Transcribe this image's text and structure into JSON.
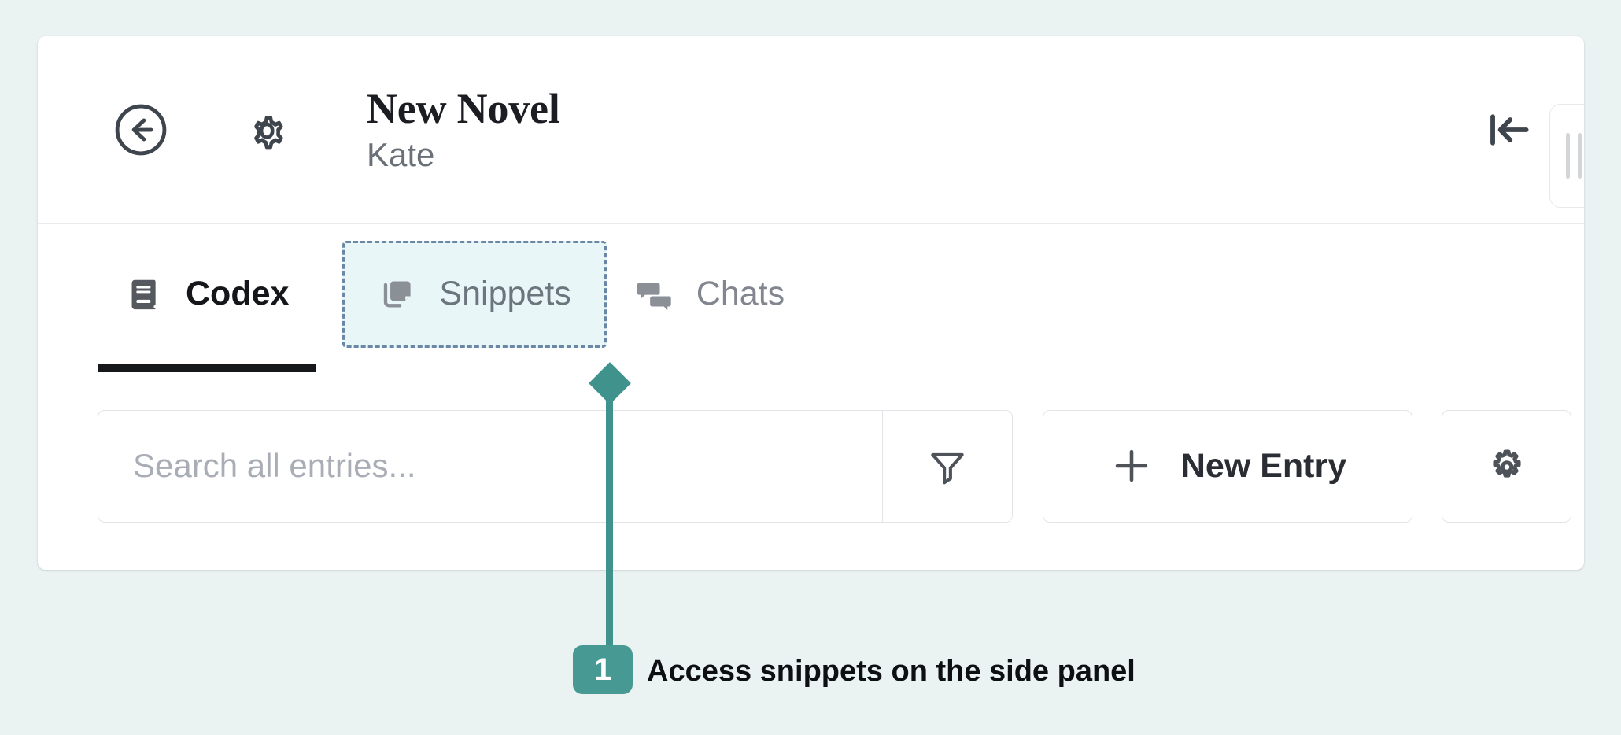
{
  "theme": {
    "page_background": "#eaf2f2",
    "panel_background": "#ffffff",
    "accent_teal": "#479a93",
    "highlight_fill": "#e9f6f8",
    "highlight_border": "#6a88a6",
    "active_tab_underline": "#16181c"
  },
  "header": {
    "back_icon": "arrow-left-circle-icon",
    "settings_icon": "gear-icon",
    "title": "New Novel",
    "author": "Kate",
    "collapse_icon": "collapse-panel-left-icon",
    "drag_handle_icon": "drag-handle-icon"
  },
  "tabs": [
    {
      "label": "Codex",
      "icon": "book-icon",
      "active": true,
      "highlighted": false
    },
    {
      "label": "Snippets",
      "icon": "copy-icon",
      "active": false,
      "highlighted": true
    },
    {
      "label": "Chats",
      "icon": "chat-bubbles-icon",
      "active": false,
      "highlighted": false
    }
  ],
  "toolbar": {
    "search_placeholder": "Search all entries...",
    "search_value": "",
    "filter_icon": "filter-funnel-icon",
    "new_entry_label": "New Entry",
    "new_entry_icon": "plus-icon",
    "codex_settings_icon": "gear-icon"
  },
  "annotation": {
    "number": "1",
    "text": "Access snippets on the side panel"
  }
}
